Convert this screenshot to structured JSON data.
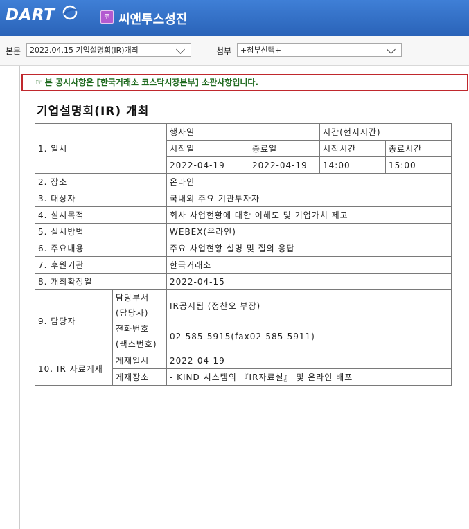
{
  "app": {
    "logo": "DART",
    "company_badge": "코",
    "company_name": "씨앤투스성진"
  },
  "toolbar": {
    "main_label": "본문",
    "main_select_value": "2022.04.15  기업설명회(IR)개최",
    "attach_label": "첨부",
    "attach_select_value": "+첨부선택+"
  },
  "notice": {
    "text": "본 공시사항은 [한국거래소 코스닥시장본부] 소관사항입니다."
  },
  "document": {
    "title": "기업설명회(IR) 개최",
    "rows": {
      "date_label": "1. 일시",
      "event_date_header": "행사일",
      "time_header": "시간(현지시간)",
      "start_date_header": "시작일",
      "end_date_header": "종료일",
      "start_time_header": "시작시간",
      "end_time_header": "종료시간",
      "start_date": "2022-04-19",
      "end_date": "2022-04-19",
      "start_time": "14:00",
      "end_time": "15:00",
      "venue_label": "2. 장소",
      "venue": "온라인",
      "target_label": "3. 대상자",
      "target": "국내외 주요 기관투자자",
      "purpose_label": "4. 실시목적",
      "purpose": "회사 사업현황에 대한 이해도 및 기업가치 제고",
      "method_label": "5. 실시방법",
      "method": "WEBEX(온라인)",
      "content_label": "6. 주요내용",
      "content": "주요 사업현황 설명 및 질의 응답",
      "sponsor_label": "7. 후원기관",
      "sponsor": "한국거래소",
      "confirm_label": "8. 개최확정일",
      "confirm_date": "2022-04-15",
      "contact_label": "9. 담당자",
      "dept_label_1": "담당부서",
      "dept_label_2": "(담당자)",
      "dept": "IR공시팀 (정찬오 부장)",
      "phone_label_1": "전화번호",
      "phone_label_2": "(팩스번호)",
      "phone": "02-585-5915(fax02-585-5911)",
      "ir_label": "10. IR 자료게재",
      "post_date_label": "게재일시",
      "post_date": "2022-04-19",
      "post_place_label": "게재장소",
      "post_place": "- KIND 시스템의 『IR자료실』 및 온라인 배포"
    }
  }
}
